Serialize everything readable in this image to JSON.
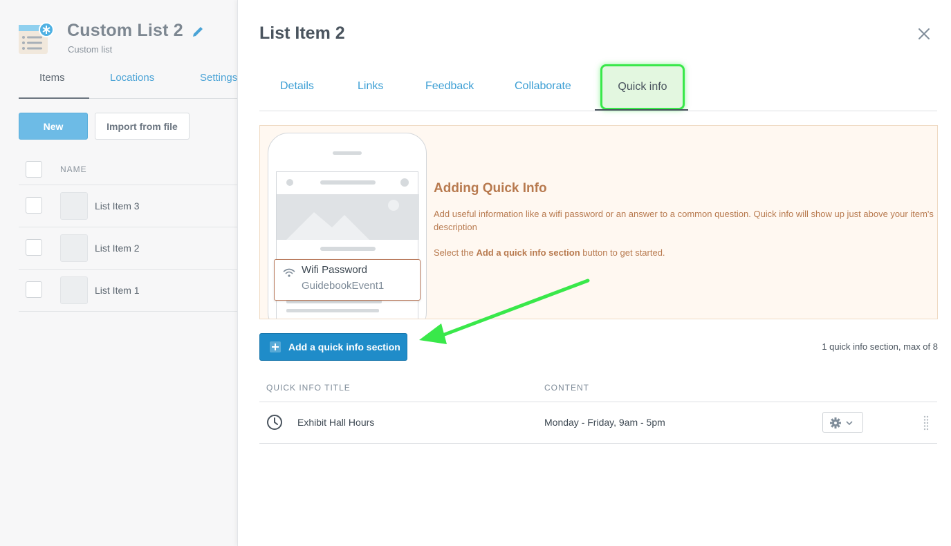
{
  "list": {
    "title": "Custom List 2",
    "subtitle": "Custom list",
    "tabs": [
      {
        "label": "Items"
      },
      {
        "label": "Locations"
      },
      {
        "label": "Settings"
      }
    ],
    "new_label": "New",
    "import_label": "Import from file",
    "name_header": "NAME",
    "items": [
      {
        "label": "List Item 3"
      },
      {
        "label": "List Item 2"
      },
      {
        "label": "List Item 1"
      }
    ]
  },
  "modal": {
    "title": "List Item 2",
    "tabs": [
      {
        "label": "Details"
      },
      {
        "label": "Links"
      },
      {
        "label": "Feedback"
      },
      {
        "label": "Collaborate"
      },
      {
        "label": "Quick info"
      }
    ],
    "info": {
      "heading": "Adding Quick Info",
      "text": "Add useful information like a wifi password or an answer to a common question. Quick info will show up just above your item's description",
      "select_prefix": "Select the ",
      "select_bold": "Add a quick info section",
      "select_suffix": " button to get started.",
      "preview_title": "Wifi Password",
      "preview_value": "GuidebookEvent1"
    },
    "add_button_label": "Add a quick info section",
    "count_text": "1 quick info section, max of 8",
    "table": {
      "col_title": "QUICK INFO TITLE",
      "col_content": "CONTENT",
      "rows": [
        {
          "title": "Exhibit Hall Hours",
          "content": "Monday - Friday, 9am - 5pm",
          "icon": "clock-icon"
        }
      ]
    }
  },
  "colors": {
    "accent": "#1f8cc9",
    "link": "#3b9ed4",
    "highlight": "#39e84a",
    "info_text": "#b87a4f"
  }
}
